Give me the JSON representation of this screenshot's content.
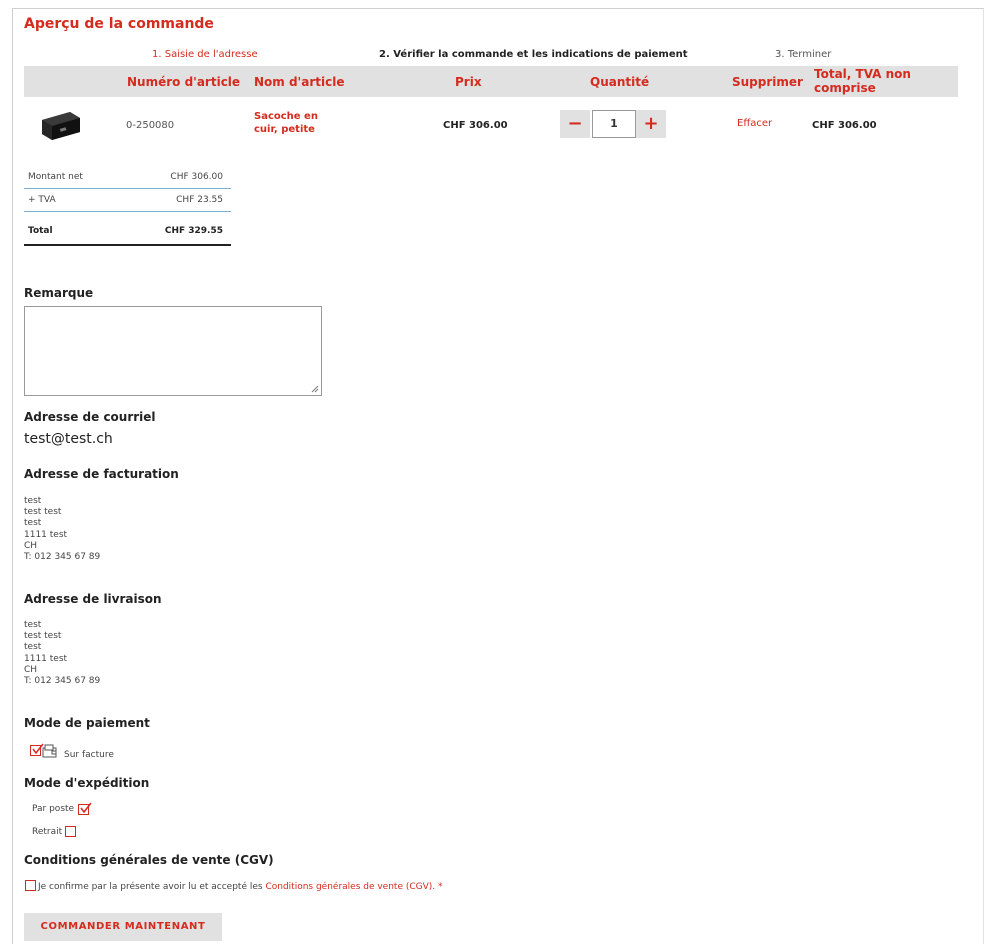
{
  "page": {
    "title": "Aperçu de la commande"
  },
  "steps": {
    "step1": "1. Saisie de l'adresse",
    "step2": "2. Vérifier la commande et les indications de paiement",
    "step3": "3. Terminer"
  },
  "table": {
    "headers": {
      "number": "Numéro d'article",
      "name": "Nom d'article",
      "price": "Prix",
      "quantity": "Quantité",
      "delete": "Supprimer",
      "total": "Total, TVA non comprise"
    },
    "row": {
      "number": "0-250080",
      "name": "Sacoche en cuir, petite",
      "price": "CHF 306.00",
      "quantity": "1",
      "delete": "Effacer",
      "total": "CHF 306.00"
    }
  },
  "totals": {
    "net_label": "Montant net",
    "net_value": "CHF 306.00",
    "vat_label": "+ TVA",
    "vat_value": "CHF 23.55",
    "total_label": "Total",
    "total_value": "CHF 329.55"
  },
  "remark": {
    "label": "Remarque",
    "value": ""
  },
  "email": {
    "label": "Adresse de courriel",
    "value": "test@test.ch"
  },
  "billing": {
    "label": "Adresse de facturation",
    "lines": [
      "test",
      "test test",
      "test",
      "1111 test",
      "CH",
      "T: 012 345 67 89"
    ]
  },
  "shipping": {
    "label": "Adresse de livraison",
    "lines": [
      "test",
      "test test",
      "test",
      "1111 test",
      "CH",
      "T: 012 345 67 89"
    ]
  },
  "payment": {
    "label": "Mode de paiement",
    "option": "Sur facture",
    "checked": true
  },
  "delivery": {
    "label": "Mode d'expédition",
    "option1": "Par poste",
    "option1_checked": true,
    "option2": "Retrait",
    "option2_checked": false
  },
  "terms": {
    "label": "Conditions générales de vente (CGV)",
    "text": "Je confirme par la présente avoir lu et accepté les",
    "link": "Conditions générales de vente (CGV).",
    "required": "*",
    "checked": false
  },
  "submit": {
    "label": "COMMANDER MAINTENANT"
  },
  "colors": {
    "accent": "#d52b1e",
    "header_bg": "#e1e1e1",
    "rule": "#7ab0d6"
  },
  "icons": {
    "payment": "invoice-icon",
    "checkmark": "checkmark-icon"
  }
}
